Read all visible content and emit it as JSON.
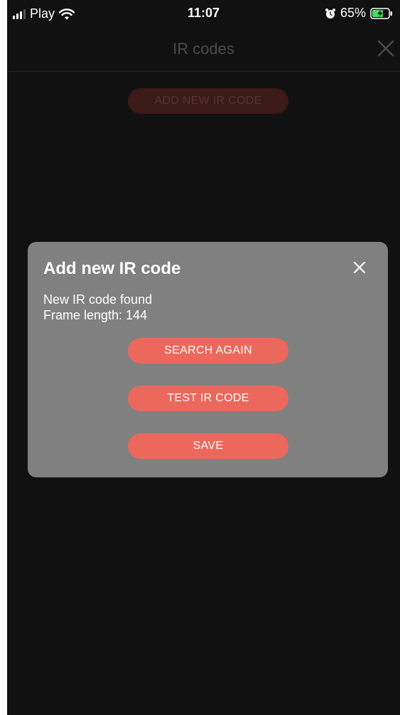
{
  "status_bar": {
    "carrier": "Play",
    "time": "11:07",
    "battery_percent": "65%"
  },
  "header": {
    "title": "IR codes"
  },
  "main": {
    "add_button_label": "ADD NEW IR CODE"
  },
  "modal": {
    "title": "Add new IR code",
    "message_line1": "New IR code found",
    "message_line2": "Frame length: 144",
    "search_again_label": "SEARCH AGAIN",
    "test_label": "TEST IR CODE",
    "save_label": "SAVE"
  },
  "colors": {
    "accent": "#ec685c",
    "screen_bg": "#111111",
    "modal_bg": "#808080",
    "battery_green": "#4cd964"
  },
  "icons": [
    "signal-icon",
    "wifi-icon",
    "alarm-icon",
    "battery-icon",
    "close-icon"
  ]
}
